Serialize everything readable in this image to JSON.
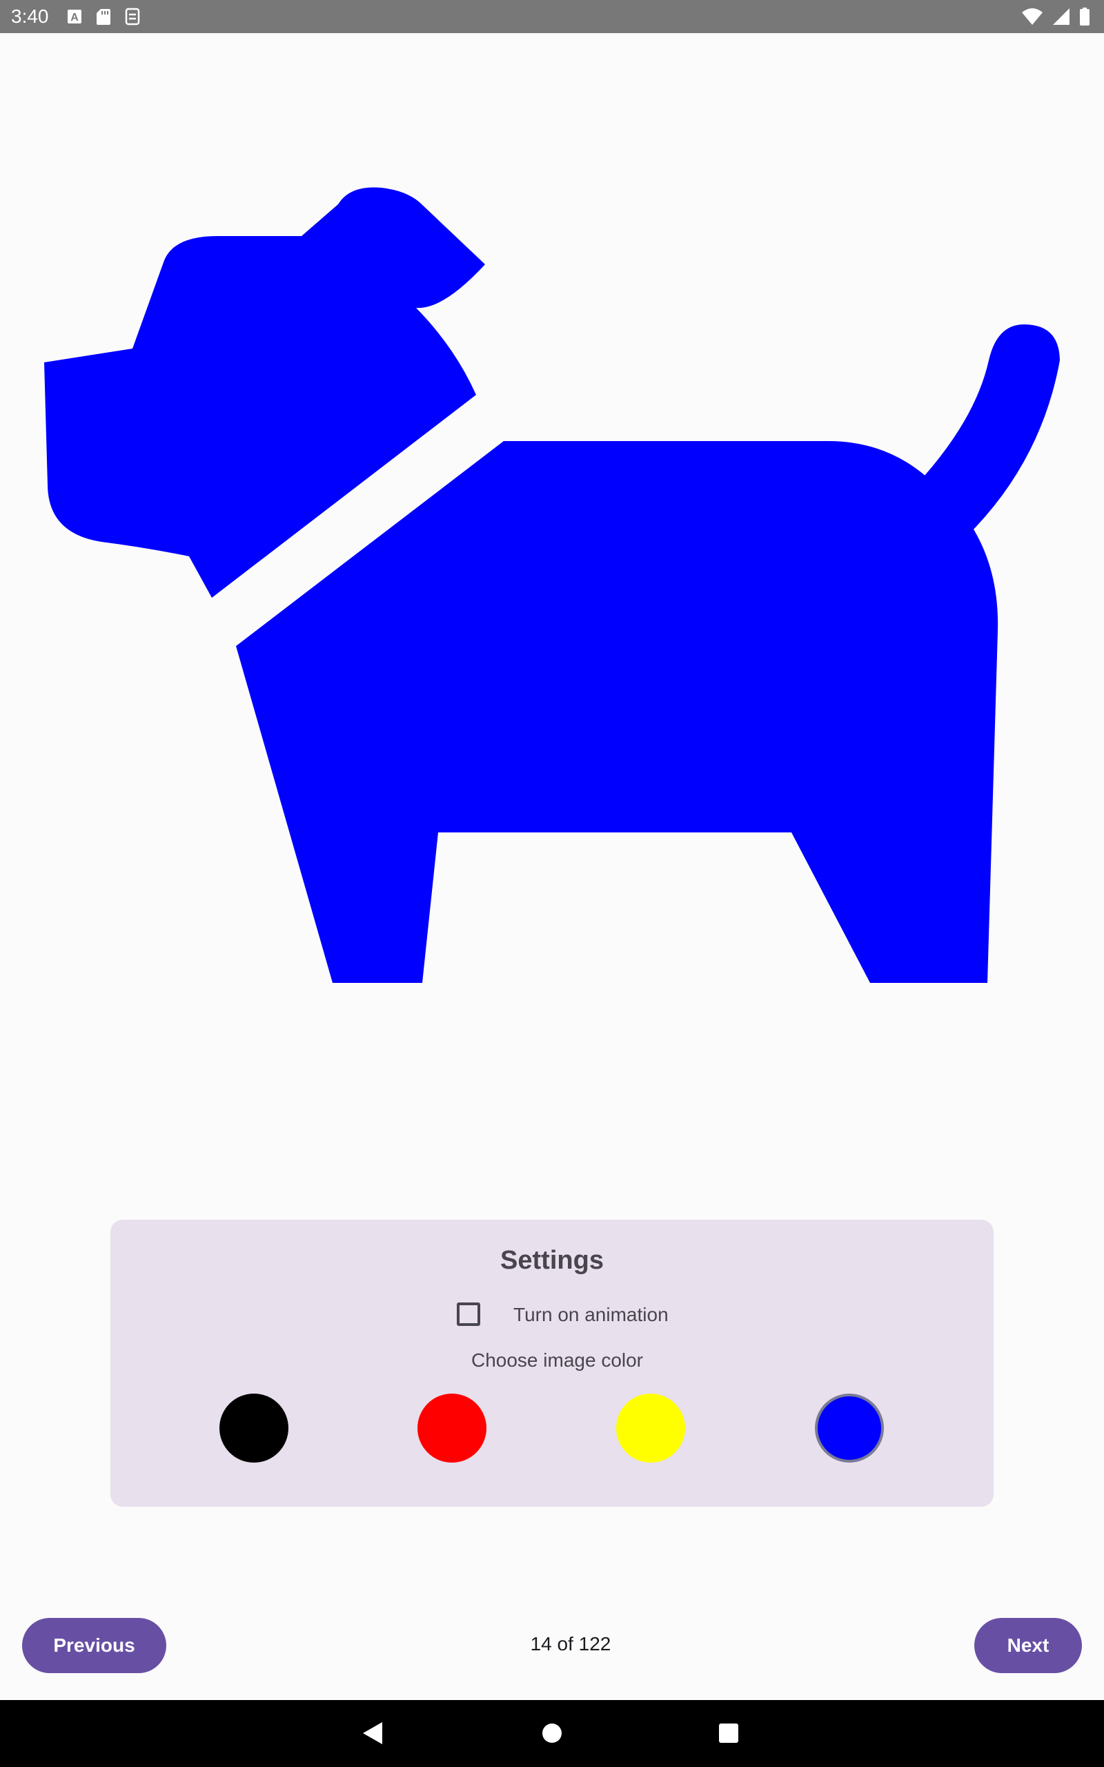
{
  "status_bar": {
    "time": "3:40",
    "left_icons": [
      "a-icon",
      "sd-card-icon",
      "sync-icon"
    ],
    "right_icons": [
      "wifi-icon",
      "signal-icon",
      "battery-icon"
    ]
  },
  "image": {
    "subject": "dog-icon",
    "color": "#0000ff"
  },
  "settings": {
    "title": "Settings",
    "animation_label": "Turn on animation",
    "animation_checked": false,
    "color_label": "Choose image color",
    "colors": [
      {
        "name": "black",
        "hex": "#000000",
        "selected": false
      },
      {
        "name": "red",
        "hex": "#ff0000",
        "selected": false
      },
      {
        "name": "yellow",
        "hex": "#ffff00",
        "selected": false
      },
      {
        "name": "blue",
        "hex": "#0000ff",
        "selected": true
      }
    ]
  },
  "navigation": {
    "previous_label": "Previous",
    "next_label": "Next",
    "page_counter": "14 of 122"
  },
  "system_nav": {
    "buttons": [
      "back-icon",
      "home-icon",
      "recents-icon"
    ]
  },
  "theme": {
    "accent": "#6750a4",
    "card_background": "#e8e0ec"
  }
}
